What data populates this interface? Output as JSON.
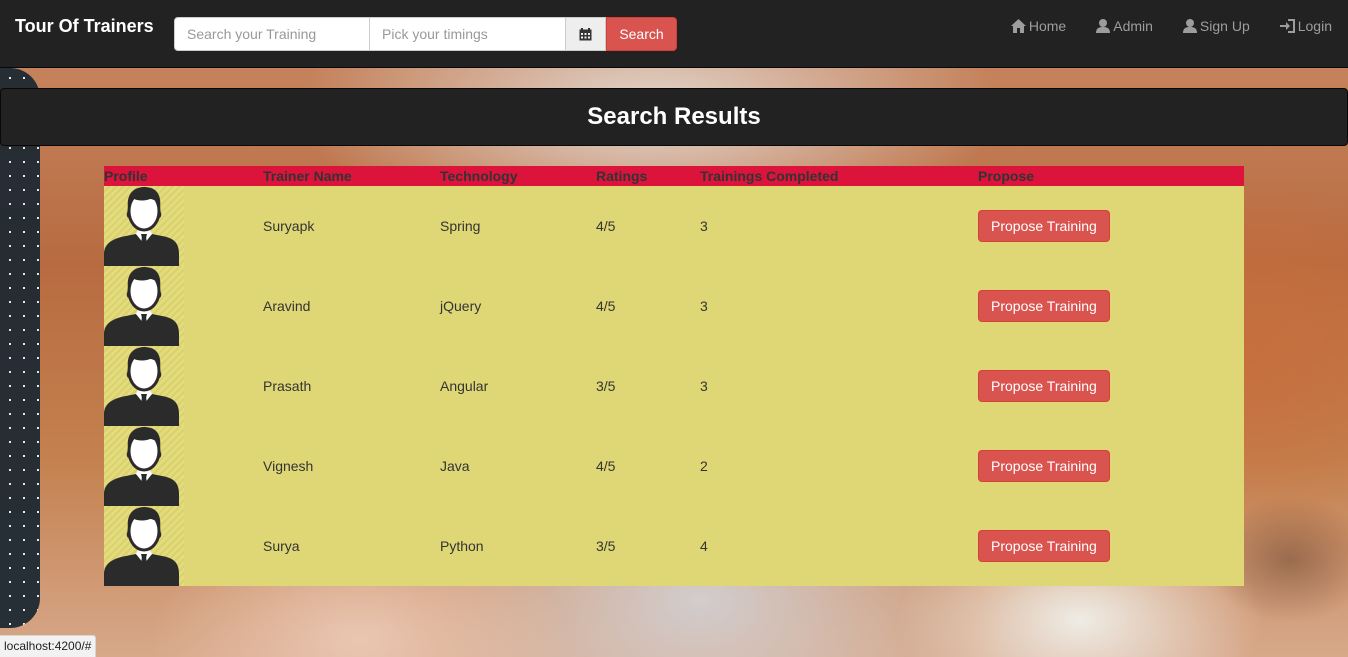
{
  "navbar": {
    "brand": "Tour Of Trainers",
    "search_placeholder": "Search your Training",
    "timing_placeholder": "Pick your timings",
    "search_button": "Search",
    "links": [
      {
        "label": "Home",
        "icon": "home-icon"
      },
      {
        "label": "Admin",
        "icon": "user-icon"
      },
      {
        "label": "Sign Up",
        "icon": "user-icon"
      },
      {
        "label": "Login",
        "icon": "log-in-icon"
      }
    ]
  },
  "results": {
    "title": "Search Results",
    "columns": [
      "Profile",
      "Trainer Name",
      "Technology",
      "Ratings",
      "Trainings Completed",
      "Propose"
    ],
    "button_label": "Propose Training",
    "rows": [
      {
        "name": "Suryapk",
        "technology": "Spring",
        "rating": "4/5",
        "completed": "3"
      },
      {
        "name": "Aravind",
        "technology": "jQuery",
        "rating": "4/5",
        "completed": "3"
      },
      {
        "name": "Prasath",
        "technology": "Angular",
        "rating": "3/5",
        "completed": "3"
      },
      {
        "name": "Vignesh",
        "technology": "Java",
        "rating": "4/5",
        "completed": "2"
      },
      {
        "name": "Surya",
        "technology": "Python",
        "rating": "3/5",
        "completed": "4"
      }
    ]
  },
  "status_bar": {
    "url": "localhost:4200/#"
  },
  "colors": {
    "navbar_bg": "#222222",
    "table_header": "#dc143c",
    "table_body": "#dfd775",
    "button_red": "#d9534f"
  }
}
